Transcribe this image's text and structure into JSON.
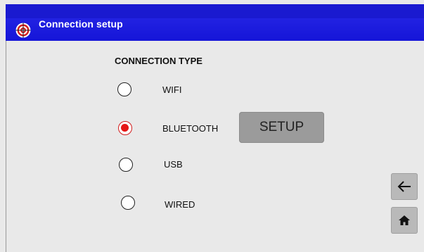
{
  "window": {
    "title": "Connection setup"
  },
  "main": {
    "heading": "CONNECTION TYPE",
    "options": [
      {
        "label": "WIFI",
        "selected": false
      },
      {
        "label": "BLUETOOTH",
        "selected": true
      },
      {
        "label": "USB",
        "selected": false
      },
      {
        "label": "WIRED",
        "selected": false
      }
    ],
    "setup_label": "SETUP"
  },
  "nav": {
    "back_icon": "arrow-left-icon",
    "home_icon": "home-icon"
  },
  "colors": {
    "titlebar": "#1515d8",
    "background": "#e9e9e9",
    "selected_radio": "#e51616",
    "setup_button": "#9b9b9b"
  }
}
